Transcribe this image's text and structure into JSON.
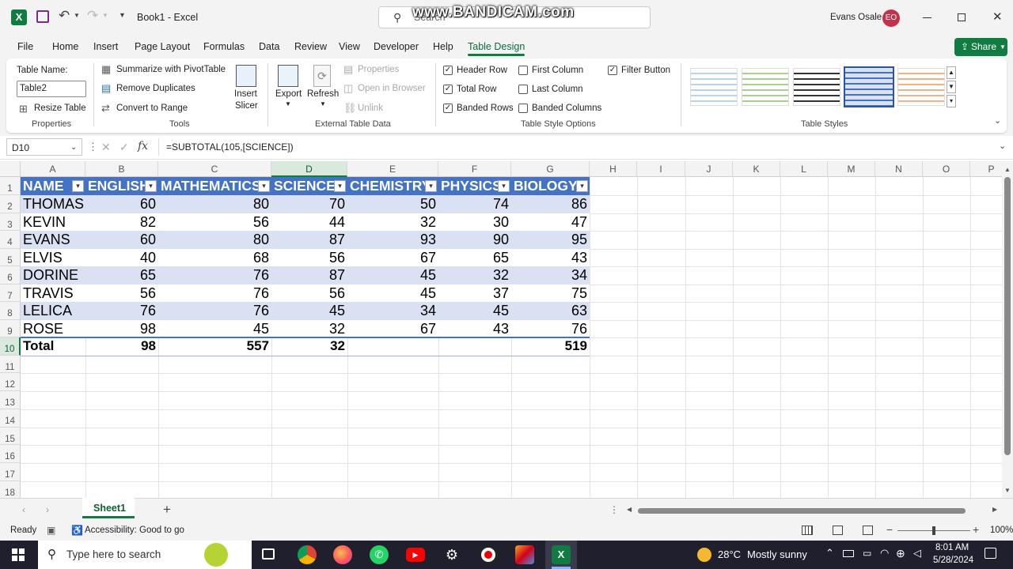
{
  "title_bar": {
    "workbook_title": "Book1 - Excel",
    "search_placeholder": "Search",
    "watermark": "www.BANDICAM.com",
    "user_name": "Evans Osale",
    "user_initials": "EO"
  },
  "menu_tabs": [
    "File",
    "Home",
    "Insert",
    "Page Layout",
    "Formulas",
    "Data",
    "Review",
    "View",
    "Developer",
    "Help",
    "Table Design"
  ],
  "active_tab": "Table Design",
  "share_label": "Share",
  "ribbon": {
    "properties": {
      "table_name_label": "Table Name:",
      "table_name_value": "Table2",
      "resize_label": "Resize Table",
      "group": "Properties"
    },
    "tools": {
      "summarize": "Summarize with PivotTable",
      "remove_duplicates": "Remove Duplicates",
      "convert": "Convert to Range",
      "insert_slicer_1": "Insert",
      "insert_slicer_2": "Slicer",
      "group": "Tools"
    },
    "external": {
      "export": "Export",
      "refresh": "Refresh",
      "properties": "Properties",
      "open_browser": "Open in Browser",
      "unlink": "Unlink",
      "group": "External Table Data"
    },
    "style_options": {
      "group": "Table Style Options",
      "options": [
        {
          "label": "Header Row",
          "checked": true
        },
        {
          "label": "Total Row",
          "checked": true
        },
        {
          "label": "Banded Rows",
          "checked": true
        },
        {
          "label": "First Column",
          "checked": false
        },
        {
          "label": "Last Column",
          "checked": false
        },
        {
          "label": "Banded Columns",
          "checked": false
        },
        {
          "label": "Filter Button",
          "checked": true
        }
      ]
    },
    "table_styles": {
      "group": "Table Styles"
    }
  },
  "formula_bar": {
    "name_box": "D10",
    "formula": "=SUBTOTAL(105,[SCIENCE])",
    "fx": "fx"
  },
  "columns": [
    "A",
    "B",
    "C",
    "D",
    "E",
    "F",
    "G",
    "H",
    "I",
    "J",
    "K",
    "L",
    "M",
    "N",
    "O",
    "P"
  ],
  "rows": [
    "1",
    "2",
    "3",
    "4",
    "5",
    "6",
    "7",
    "8",
    "9",
    "10",
    "11",
    "12",
    "13",
    "14",
    "15",
    "16",
    "17",
    "18"
  ],
  "table": {
    "headers": [
      "NAME",
      "ENGLISH",
      "MATHEMATICS",
      "SCIENCE",
      "CHEMISTRY",
      "PHYSICS",
      "BIOLOGY"
    ],
    "data": [
      [
        "THOMAS",
        "60",
        "80",
        "70",
        "50",
        "74",
        "86"
      ],
      [
        "KEVIN",
        "82",
        "56",
        "44",
        "32",
        "30",
        "47"
      ],
      [
        "EVANS",
        "60",
        "80",
        "87",
        "93",
        "90",
        "95"
      ],
      [
        "ELVIS",
        "40",
        "68",
        "56",
        "67",
        "65",
        "43"
      ],
      [
        "DORINE",
        "65",
        "76",
        "87",
        "45",
        "32",
        "34"
      ],
      [
        "TRAVIS",
        "56",
        "76",
        "56",
        "45",
        "37",
        "75"
      ],
      [
        "LELICA",
        "76",
        "76",
        "45",
        "34",
        "45",
        "63"
      ],
      [
        "ROSE",
        "98",
        "45",
        "32",
        "67",
        "43",
        "76"
      ]
    ],
    "total": [
      "Total",
      "98",
      "557",
      "32",
      "",
      "",
      "519"
    ]
  },
  "sheet_tab": "Sheet1",
  "status": {
    "ready": "Ready",
    "accessibility": "Accessibility: Good to go",
    "zoom": "100%"
  },
  "taskbar": {
    "search_placeholder": "Type here to search",
    "temperature": "28°C",
    "weather": "Mostly sunny",
    "time": "8:01 AM",
    "date": "5/28/2024"
  },
  "colors": {
    "excel_green": "#107c41",
    "table_header": "#4472c4",
    "band": "#d9e1f2",
    "avatar": "#c4314b"
  }
}
